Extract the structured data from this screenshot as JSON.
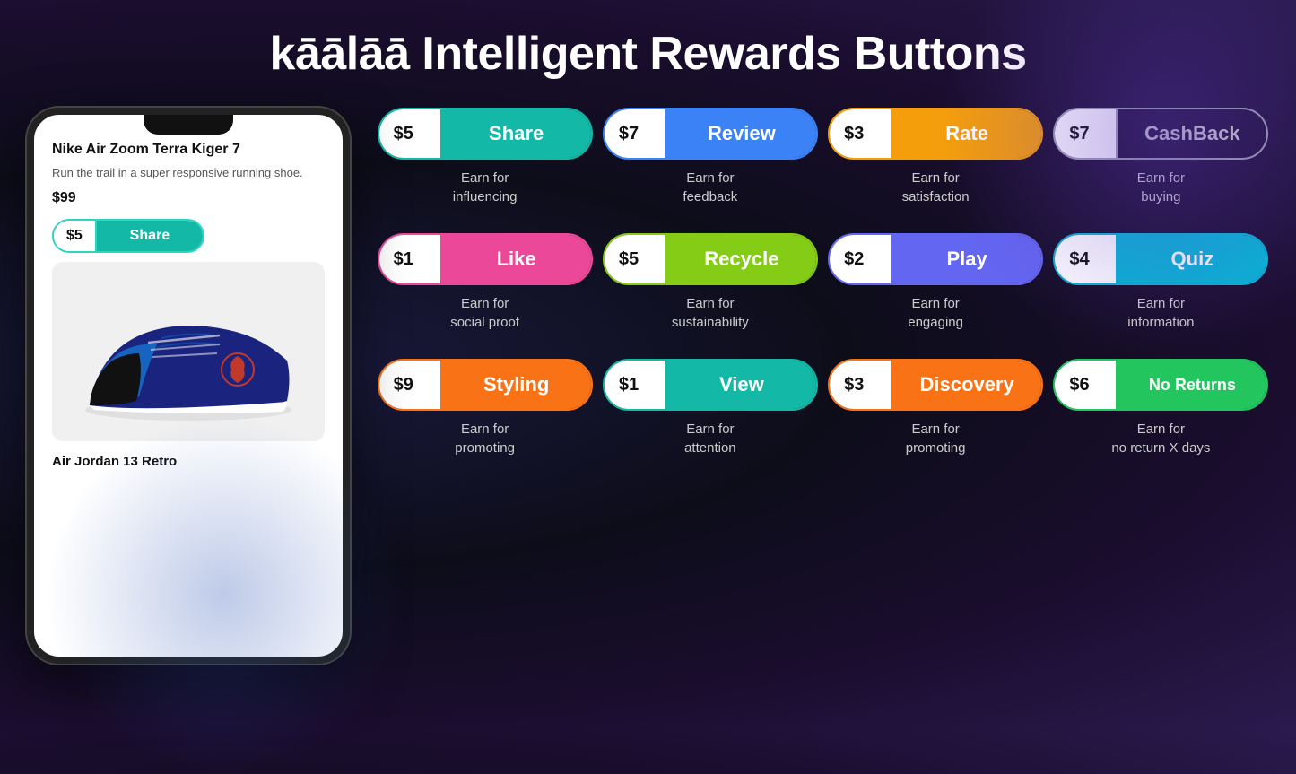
{
  "page": {
    "title": "kāālāā Intelligent Rewards Buttons"
  },
  "phone": {
    "product_name": "Nike Air Zoom Terra Kiger 7",
    "product_desc": "Run the trail in a super responsive running shoe.",
    "product_price": "$99",
    "share_amount": "$5",
    "share_label": "Share",
    "product_name2": "Air Jordan 13 Retro"
  },
  "rewards": [
    {
      "amount": "$5",
      "label": "Share",
      "desc_line1": "Earn for",
      "desc_line2": "influencing",
      "color_class": "btn-share"
    },
    {
      "amount": "$7",
      "label": "Review",
      "desc_line1": "Earn for",
      "desc_line2": "feedback",
      "color_class": "btn-review"
    },
    {
      "amount": "$3",
      "label": "Rate",
      "desc_line1": "Earn for",
      "desc_line2": "satisfaction",
      "color_class": "btn-rate"
    },
    {
      "amount": "$7",
      "label": "CashBack",
      "desc_line1": "Earn for",
      "desc_line2": "buying",
      "color_class": "btn-cashback"
    },
    {
      "amount": "$1",
      "label": "Like",
      "desc_line1": "Earn for",
      "desc_line2": "social proof",
      "color_class": "btn-like"
    },
    {
      "amount": "$5",
      "label": "Recycle",
      "desc_line1": "Earn for",
      "desc_line2": "sustainability",
      "color_class": "btn-recycle"
    },
    {
      "amount": "$2",
      "label": "Play",
      "desc_line1": "Earn for",
      "desc_line2": "engaging",
      "color_class": "btn-play"
    },
    {
      "amount": "$4",
      "label": "Quiz",
      "desc_line1": "Earn for",
      "desc_line2": "information",
      "color_class": "btn-quiz"
    },
    {
      "amount": "$9",
      "label": "Styling",
      "desc_line1": "Earn for",
      "desc_line2": "promoting",
      "color_class": "btn-styling"
    },
    {
      "amount": "$1",
      "label": "View",
      "desc_line1": "Earn for",
      "desc_line2": "attention",
      "color_class": "btn-view"
    },
    {
      "amount": "$3",
      "label": "Discovery",
      "desc_line1": "Earn for",
      "desc_line2": "promoting",
      "color_class": "btn-discovery"
    },
    {
      "amount": "$6",
      "label": "No Returns",
      "desc_line1": "Earn for",
      "desc_line2": "no return X days",
      "color_class": "btn-noreturns"
    }
  ]
}
